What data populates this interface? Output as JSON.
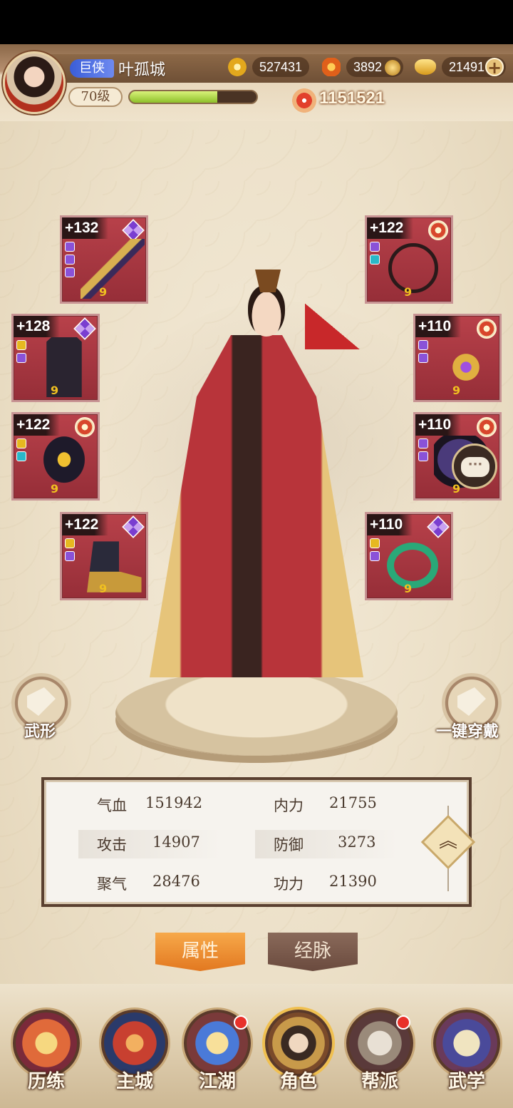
{
  "header": {
    "title_badge": "巨侠",
    "player_name": "叶孤城",
    "level": "70级",
    "exp_fraction": 0.69,
    "coins": "527431",
    "leaves": "3892",
    "ingots": "21491",
    "power": "1151521"
  },
  "equipment": {
    "left": [
      {
        "level": "+132",
        "grade": "purple",
        "gems": [
          "p",
          "p",
          "p"
        ],
        "icon": "sword-icon"
      },
      {
        "level": "+128",
        "grade": "purple",
        "gems": [
          "y",
          "p"
        ],
        "icon": "robe-icon"
      },
      {
        "level": "+122",
        "grade": "red",
        "gems": [
          "y",
          "c"
        ],
        "icon": "belt-icon"
      },
      {
        "level": "+122",
        "grade": "purple",
        "gems": [
          "y",
          "p"
        ],
        "icon": "boots-icon"
      }
    ],
    "right": [
      {
        "level": "+122",
        "grade": "red",
        "gems": [
          "p",
          "c"
        ],
        "icon": "necklace-icon"
      },
      {
        "level": "+110",
        "grade": "red",
        "gems": [
          "p",
          "p"
        ],
        "icon": "hairpin-icon"
      },
      {
        "level": "+110",
        "grade": "red",
        "gems": [
          "p",
          "p"
        ],
        "icon": "hat-icon"
      },
      {
        "level": "+110",
        "grade": "purple",
        "gems": [
          "y",
          "p"
        ],
        "icon": "ring-icon"
      }
    ],
    "enhance_mark": "9"
  },
  "actions": {
    "appearance_label": "武形",
    "auto_equip_label": "一键穿戴"
  },
  "stats": [
    {
      "label": "气血",
      "value": "151942"
    },
    {
      "label": "内力",
      "value": "21755"
    },
    {
      "label": "攻击",
      "value": "14907"
    },
    {
      "label": "防御",
      "value": "3273"
    },
    {
      "label": "聚气",
      "value": "28476"
    },
    {
      "label": "功力",
      "value": "21390"
    }
  ],
  "tabs": [
    {
      "label": "属性",
      "active": true
    },
    {
      "label": "经脉",
      "active": false
    }
  ],
  "nav": [
    {
      "label": "历练",
      "badge": false,
      "icon": "training-icon"
    },
    {
      "label": "主城",
      "badge": false,
      "icon": "city-icon"
    },
    {
      "label": "江湖",
      "badge": true,
      "icon": "jianghu-icon"
    },
    {
      "label": "角色",
      "badge": false,
      "icon": "character-icon",
      "active": true
    },
    {
      "label": "帮派",
      "badge": true,
      "icon": "guild-icon"
    },
    {
      "label": "武学",
      "badge": false,
      "icon": "martial-arts-icon"
    }
  ],
  "colors": {
    "accent": "#e27820",
    "equip_bg": "#a8363f",
    "exp_fill": "#a6d63c",
    "badge_red": "#e8312a"
  }
}
